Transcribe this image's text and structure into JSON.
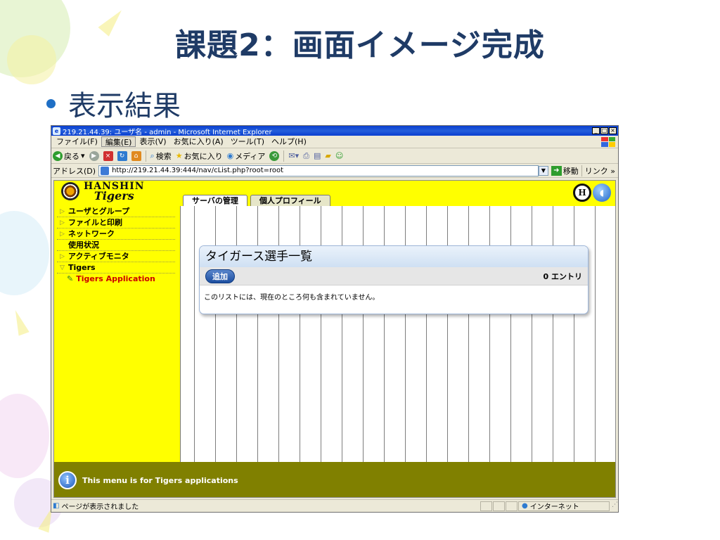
{
  "slide": {
    "title": "課題2：画面イメージ完成",
    "bullet": "表示結果"
  },
  "browser": {
    "window_title": "219.21.44.39: ユーザ名 - admin - Microsoft Internet Explorer",
    "menu": [
      "ファイル(F)",
      "編集(E)",
      "表示(V)",
      "お気に入り(A)",
      "ツール(T)",
      "ヘルプ(H)"
    ],
    "toolbar": {
      "back": "戻る",
      "search": "検索",
      "favorites": "お気に入り",
      "media": "メディア"
    },
    "address_label": "アドレス(D)",
    "address_url": "http://219.21.44.39:444/nav/cList.php?root=root",
    "go_label": "移動",
    "links_label": "リンク »",
    "status_text": "ページが表示されました",
    "zone_text": "インターネット"
  },
  "app": {
    "logo_brand": "HANSHIN",
    "logo_team": "Tigers",
    "tabs": [
      "サーバの管理",
      "個人プロフィール"
    ],
    "sidebar": [
      {
        "label": "ユーザとグループ",
        "type": "collapsed"
      },
      {
        "label": "ファイルと印刷",
        "type": "collapsed"
      },
      {
        "label": "ネットワーク",
        "type": "collapsed"
      },
      {
        "label": "使用状況",
        "type": "plain"
      },
      {
        "label": "アクティブモニタ",
        "type": "collapsed"
      },
      {
        "label": "Tigers",
        "type": "expanded"
      },
      {
        "label": "Tigers Application",
        "type": "sub"
      }
    ],
    "panel": {
      "title": "タイガース選手一覧",
      "add_label": "追加",
      "entry_count": "0 エントリ",
      "empty_message": "このリストには、現在のところ何も含まれていません。"
    },
    "info_text": "This menu is for Tigers applications"
  }
}
